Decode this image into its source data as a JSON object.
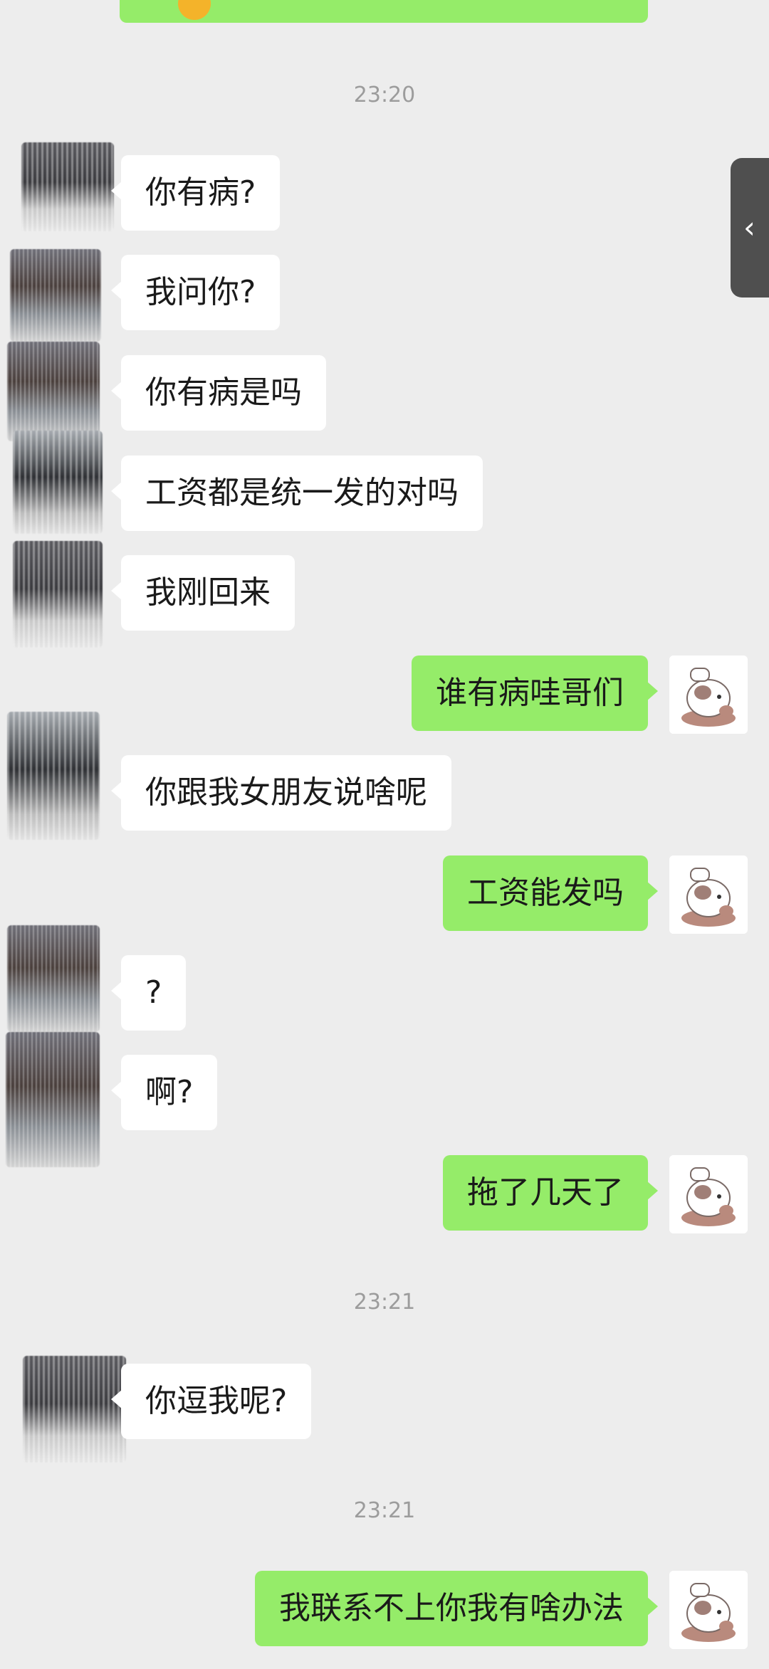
{
  "chat": {
    "timestamps": [
      "23:20",
      "23:21",
      "23:21"
    ],
    "messages": [
      {
        "side": "left",
        "text": "你有病?"
      },
      {
        "side": "left",
        "text": "我问你?"
      },
      {
        "side": "left",
        "text": "你有病是吗"
      },
      {
        "side": "left",
        "text": "工资都是统一发的对吗"
      },
      {
        "side": "left",
        "text": "我刚回来"
      },
      {
        "side": "right",
        "text": "谁有病哇哥们"
      },
      {
        "side": "left",
        "text": "你跟我女朋友说啥呢"
      },
      {
        "side": "right",
        "text": "工资能发吗"
      },
      {
        "side": "left",
        "text": "?"
      },
      {
        "side": "left",
        "text": "啊?"
      },
      {
        "side": "right",
        "text": "拖了几天了"
      },
      {
        "side": "left",
        "text": "你逗我呢?"
      },
      {
        "side": "right",
        "text": "我联系不上你我有啥办法"
      }
    ]
  },
  "side_handle": {
    "icon": "chevron-left-icon",
    "glyph": "‹"
  },
  "colors": {
    "background": "#ededed",
    "outgoing_bubble": "#95ec69",
    "incoming_bubble": "#ffffff",
    "timestamp": "#9c9c9c"
  }
}
